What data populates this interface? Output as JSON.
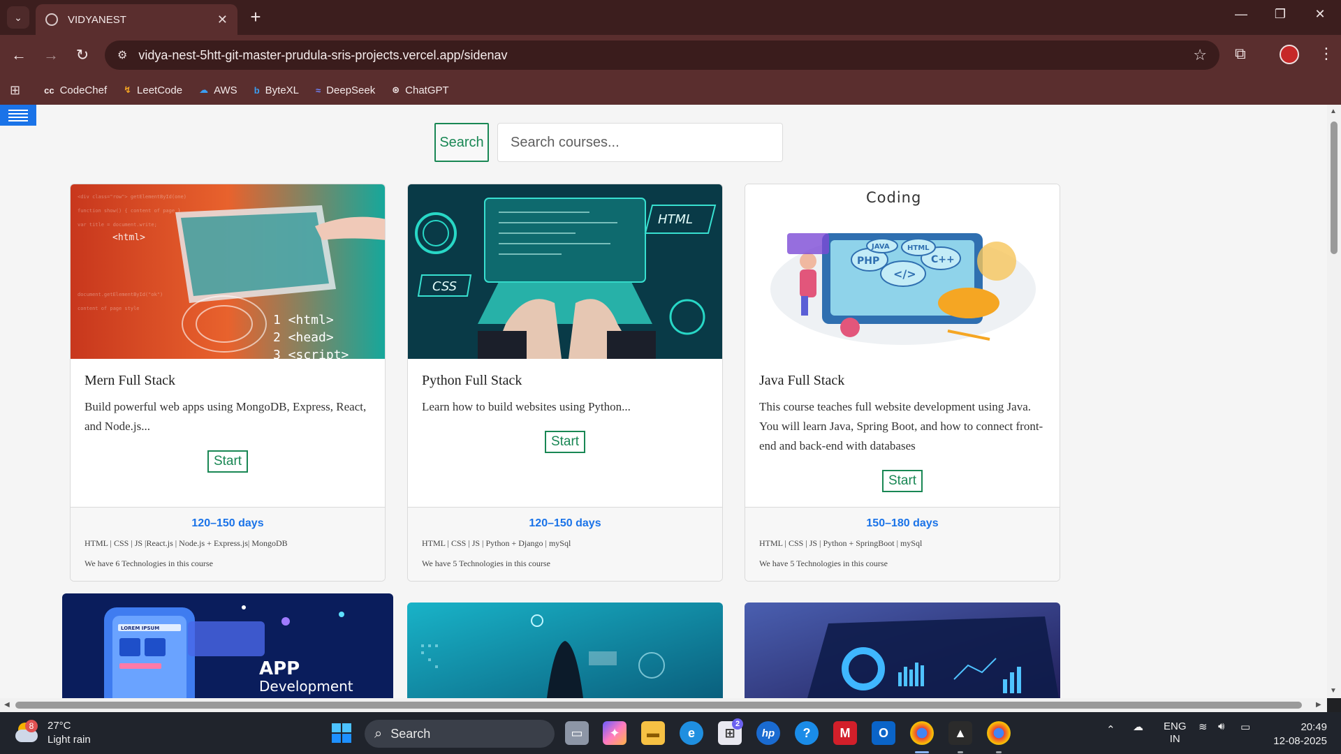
{
  "browser": {
    "tab_title": "VIDYANEST",
    "tab_close": "✕",
    "new_tab": "+",
    "url": "vidya-nest-5htt-git-master-prudula-sris-projects.vercel.app/sidenav",
    "bookmarks": [
      {
        "label": "CodeChef",
        "icon": "cc",
        "color": "#ffffff"
      },
      {
        "label": "LeetCode",
        "icon": "↯",
        "color": "#f5a623"
      },
      {
        "label": "AWS",
        "icon": "☁",
        "color": "#3c9df0"
      },
      {
        "label": "ByteXL",
        "icon": "b",
        "color": "#3c9df0"
      },
      {
        "label": "DeepSeek",
        "icon": "🐋",
        "color": "#4d6bfe"
      },
      {
        "label": "ChatGPT",
        "icon": "⊛",
        "color": "#ffffff"
      }
    ]
  },
  "page": {
    "search_button": "Search",
    "search_placeholder": "Search courses...",
    "courses": [
      {
        "title": "Mern Full Stack",
        "description": "Build powerful web apps using MongoDB, Express, React, and Node.js...",
        "start_label": "Start",
        "duration": "120–150 days",
        "technologies": "HTML | CSS | JS |React.js | Node.js + Express.js| MongoDB",
        "tech_count": "We have 6 Technologies in this course"
      },
      {
        "title": "Python Full Stack",
        "description": "Learn how to build websites using Python...",
        "start_label": "Start",
        "duration": "120–150 days",
        "technologies": "HTML | CSS | JS | Python + Django | mySql",
        "tech_count": "We have 5 Technologies in this course"
      },
      {
        "title": "Java Full Stack",
        "description": "This course teaches full website development using Java. You will learn Java, Spring Boot, and how to connect front-end and back-end with databases",
        "start_label": "Start",
        "duration": "150–180 days",
        "technologies": "HTML | CSS | JS | Python + SpringBoot | mySql",
        "tech_count": "We have 5 Technologies in this course"
      }
    ],
    "image_labels": {
      "coding": "Coding",
      "html": "HTML",
      "css": "CSS",
      "php": "PHP",
      "cpp": "C++",
      "java": "JAVA",
      "app_dev_1": "APP",
      "app_dev_2": "Development",
      "lorem": "LOREM IPSUM"
    }
  },
  "taskbar": {
    "weather_temp": "27°C",
    "weather_desc": "Light rain",
    "weather_badge": "8",
    "search_label": "Search",
    "store_badge": "2",
    "lang_1": "ENG",
    "lang_2": "IN",
    "time": "20:49",
    "date": "12-08-2025"
  }
}
